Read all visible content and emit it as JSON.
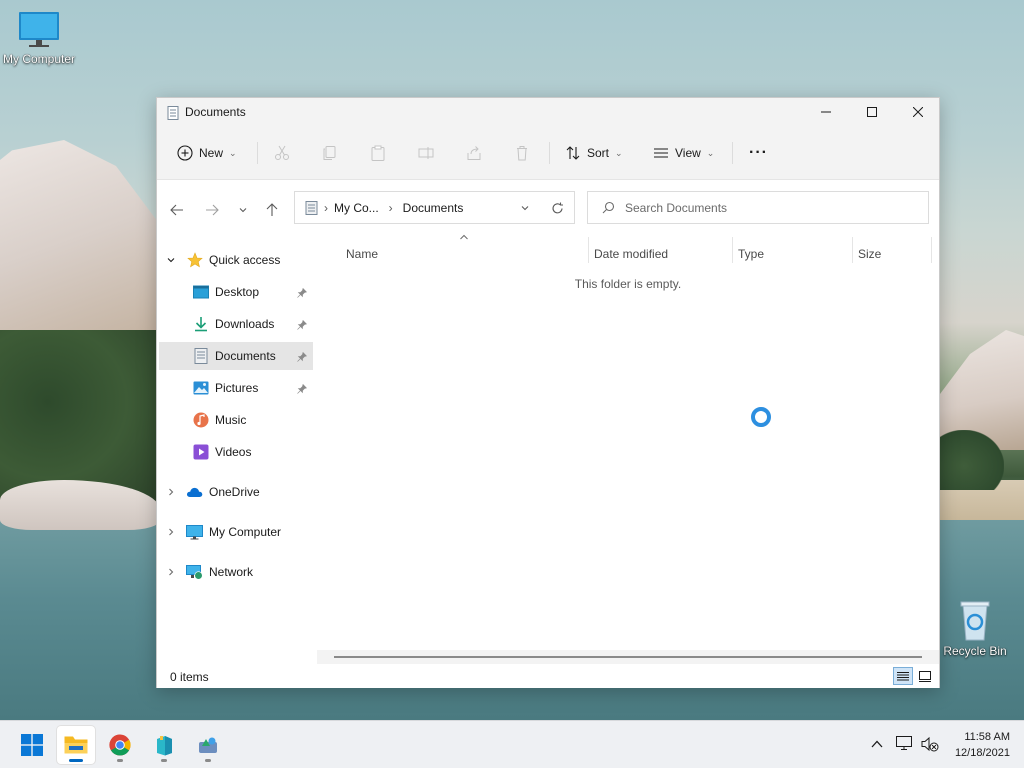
{
  "desktop": {
    "icons": [
      {
        "label": "My Computer",
        "icon": "monitor-icon"
      },
      {
        "label": "Recycle Bin",
        "icon": "recycle-bin-icon"
      }
    ]
  },
  "window": {
    "title": "Documents",
    "controls": {
      "minimize": "minimize-icon",
      "maximize": "maximize-icon",
      "close": "close-icon"
    },
    "toolbar": {
      "new_label": "New",
      "sort_label": "Sort",
      "view_label": "View",
      "disabled_actions": [
        "cut",
        "copy",
        "paste",
        "rename",
        "share",
        "delete"
      ],
      "more_label": "···"
    },
    "address": {
      "breadcrumb": [
        "My Co...",
        "Documents"
      ],
      "search_placeholder": "Search Documents"
    },
    "nav_pane": {
      "quick_access": "Quick access",
      "quick_items": [
        {
          "label": "Desktop",
          "icon": "desktop-folder-icon",
          "pinned": true
        },
        {
          "label": "Downloads",
          "icon": "download-icon",
          "pinned": true
        },
        {
          "label": "Documents",
          "icon": "documents-icon",
          "pinned": true,
          "selected": true
        },
        {
          "label": "Pictures",
          "icon": "pictures-icon",
          "pinned": true
        },
        {
          "label": "Music",
          "icon": "music-icon",
          "pinned": false
        },
        {
          "label": "Videos",
          "icon": "videos-icon",
          "pinned": false
        }
      ],
      "roots": [
        {
          "label": "OneDrive",
          "icon": "cloud-icon"
        },
        {
          "label": "My Computer",
          "icon": "monitor-icon"
        },
        {
          "label": "Network",
          "icon": "network-icon"
        }
      ]
    },
    "columns": [
      "Name",
      "Date modified",
      "Type",
      "Size"
    ],
    "empty_message": "This folder is empty.",
    "status": {
      "count": "0 items"
    }
  },
  "taskbar": {
    "apps": [
      "start",
      "file-explorer",
      "chrome",
      "app-installer",
      "app-extra"
    ],
    "clock": {
      "time": "11:58 AM",
      "date": "12/18/2021"
    }
  },
  "colors": {
    "accent": "#0067c0",
    "spinner": "#2d8fe0",
    "selected_nav": "#e5e5e5"
  }
}
